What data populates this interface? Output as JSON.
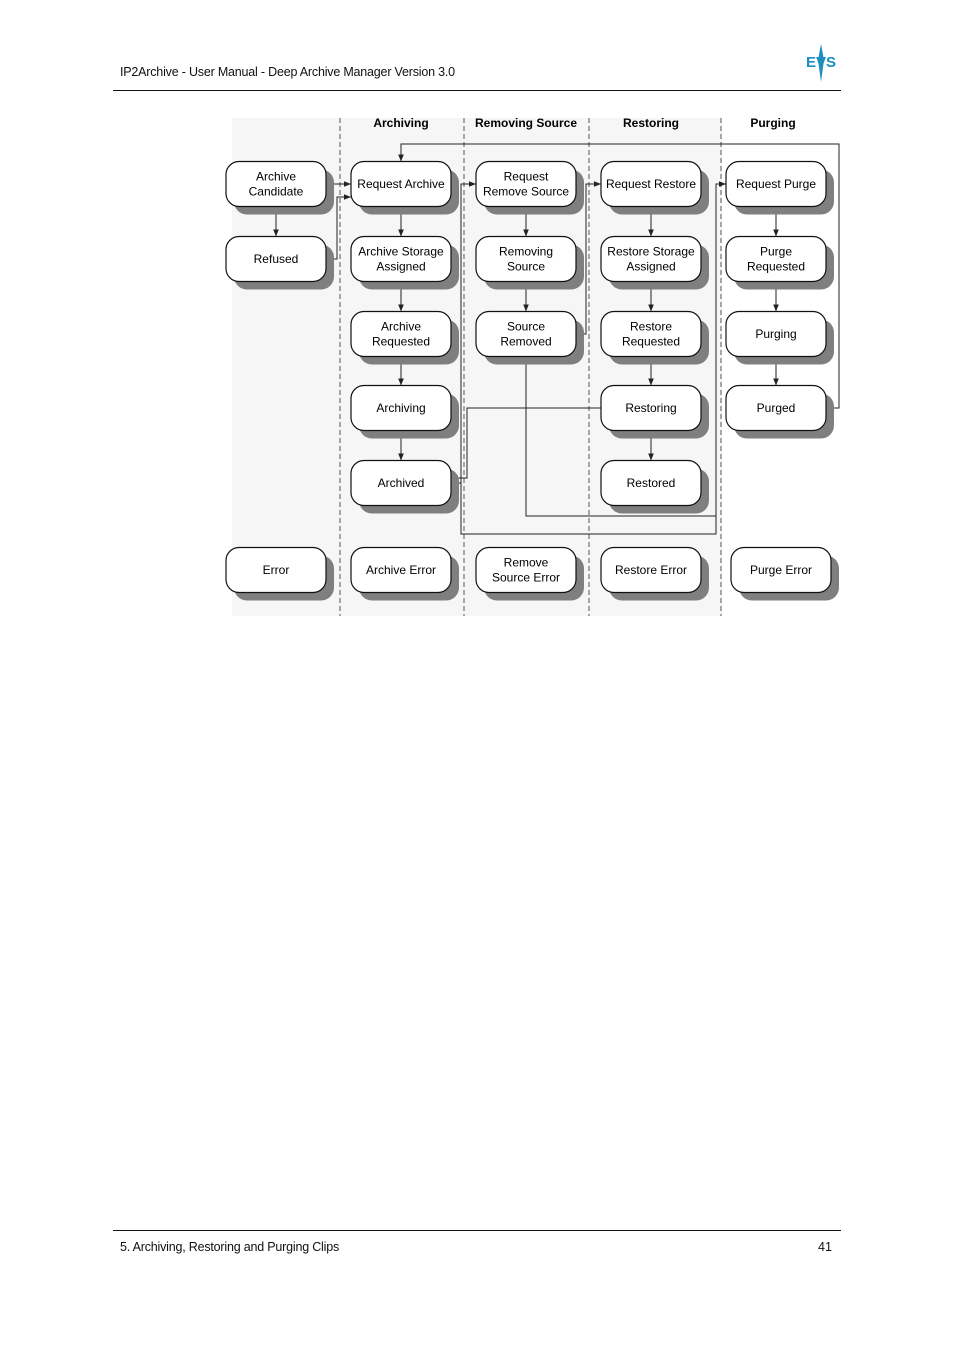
{
  "header": {
    "title": "IP2Archive - User Manual - Deep Archive Manager Version 3.0",
    "logo": "EVS",
    "logo_color": "#1a8fc0"
  },
  "footer": {
    "chapter": "5. Archiving, Restoring and Purging Clips",
    "page_number": "41"
  },
  "diagram": {
    "lanes": [
      {
        "id": "pre",
        "title": ""
      },
      {
        "id": "archiving",
        "title": "Archiving"
      },
      {
        "id": "removing",
        "title": "Removing Source"
      },
      {
        "id": "restoring",
        "title": "Restoring"
      },
      {
        "id": "purging",
        "title": "Purging"
      }
    ],
    "states": [
      {
        "id": "archive-candidate",
        "lane": 0,
        "row": 0,
        "lines": [
          "Archive",
          "Candidate"
        ]
      },
      {
        "id": "refused",
        "lane": 0,
        "row": 1,
        "lines": [
          "Refused"
        ]
      },
      {
        "id": "error",
        "lane": 0,
        "row": 5,
        "lines": [
          "Error"
        ]
      },
      {
        "id": "request-archive",
        "lane": 1,
        "row": 0,
        "lines": [
          "Request Archive"
        ]
      },
      {
        "id": "archive-storage-assigned",
        "lane": 1,
        "row": 1,
        "lines": [
          "Archive Storage",
          "Assigned"
        ]
      },
      {
        "id": "archive-requested",
        "lane": 1,
        "row": 2,
        "lines": [
          "Archive",
          "Requested"
        ]
      },
      {
        "id": "archiving",
        "lane": 1,
        "row": 3,
        "lines": [
          "Archiving"
        ]
      },
      {
        "id": "archived",
        "lane": 1,
        "row": 4,
        "lines": [
          "Archived"
        ]
      },
      {
        "id": "archive-error",
        "lane": 1,
        "row": 5,
        "lines": [
          "Archive Error"
        ]
      },
      {
        "id": "request-remove-source",
        "lane": 2,
        "row": 0,
        "lines": [
          "Request",
          "Remove Source"
        ]
      },
      {
        "id": "removing-source",
        "lane": 2,
        "row": 1,
        "lines": [
          "Removing",
          "Source"
        ]
      },
      {
        "id": "source-removed",
        "lane": 2,
        "row": 2,
        "lines": [
          "Source",
          "Removed"
        ]
      },
      {
        "id": "remove-source-error",
        "lane": 2,
        "row": 5,
        "lines": [
          "Remove",
          "Source Error"
        ]
      },
      {
        "id": "request-restore",
        "lane": 3,
        "row": 0,
        "lines": [
          "Request Restore"
        ]
      },
      {
        "id": "restore-storage-assigned",
        "lane": 3,
        "row": 1,
        "lines": [
          "Restore Storage",
          "Assigned"
        ]
      },
      {
        "id": "restore-requested",
        "lane": 3,
        "row": 2,
        "lines": [
          "Restore",
          "Requested"
        ]
      },
      {
        "id": "restoring",
        "lane": 3,
        "row": 3,
        "lines": [
          "Restoring"
        ]
      },
      {
        "id": "restored",
        "lane": 3,
        "row": 4,
        "lines": [
          "Restored"
        ]
      },
      {
        "id": "restore-error",
        "lane": 3,
        "row": 5,
        "lines": [
          "Restore Error"
        ]
      },
      {
        "id": "request-purge",
        "lane": 4,
        "row": 0,
        "lines": [
          "Request Purge"
        ]
      },
      {
        "id": "purge-requested",
        "lane": 4,
        "row": 1,
        "lines": [
          "Purge",
          "Requested"
        ]
      },
      {
        "id": "purging",
        "lane": 4,
        "row": 2,
        "lines": [
          "Purging"
        ]
      },
      {
        "id": "purged",
        "lane": 4,
        "row": 3,
        "lines": [
          "Purged"
        ]
      },
      {
        "id": "purge-error",
        "lane": 4,
        "row": 5,
        "lines": [
          "Purge Error"
        ]
      }
    ],
    "transitions": [
      {
        "from": "archive-candidate",
        "to": "refused"
      },
      {
        "from": "archive-candidate",
        "to": "request-archive"
      },
      {
        "from": "refused",
        "to": "request-archive"
      },
      {
        "from": "request-archive",
        "to": "archive-storage-assigned"
      },
      {
        "from": "archive-storage-assigned",
        "to": "archive-requested"
      },
      {
        "from": "archive-requested",
        "to": "archiving"
      },
      {
        "from": "archiving",
        "to": "archived"
      },
      {
        "from": "archived",
        "to": "request-remove-source"
      },
      {
        "from": "archived",
        "to": "request-purge"
      },
      {
        "from": "request-remove-source",
        "to": "removing-source"
      },
      {
        "from": "removing-source",
        "to": "source-removed"
      },
      {
        "from": "source-removed",
        "to": "request-restore"
      },
      {
        "from": "source-removed",
        "to": "request-purge"
      },
      {
        "from": "request-restore",
        "to": "restore-storage-assigned"
      },
      {
        "from": "restore-storage-assigned",
        "to": "restore-requested"
      },
      {
        "from": "restore-requested",
        "to": "restoring"
      },
      {
        "from": "restoring",
        "to": "restored"
      },
      {
        "from": "restoring",
        "to": "archived"
      },
      {
        "from": "request-purge",
        "to": "purge-requested"
      },
      {
        "from": "purge-requested",
        "to": "purging"
      },
      {
        "from": "purging",
        "to": "purged"
      },
      {
        "from": "purged",
        "to": "request-archive"
      }
    ],
    "colors": {
      "box_fill": "#ffffff",
      "box_stroke": "#111111",
      "shadow": "#7f7f7f",
      "line": "#222222",
      "lane_divider": "#555555",
      "background_tint": "#f6f6f6"
    }
  }
}
